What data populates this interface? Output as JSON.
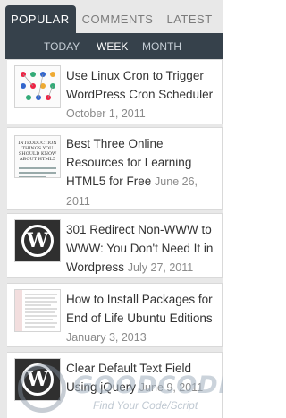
{
  "tabs": [
    "POPULAR",
    "COMMENTS",
    "LATEST"
  ],
  "subtabs": [
    "TODAY",
    "WEEK",
    "MONTH"
  ],
  "posts": [
    {
      "title": "Use Linux Cron to Trigger WordPress Cron Scheduler",
      "date": "October 1, 2011"
    },
    {
      "title": "Best Three Online Resources for Learning HTML5 for Free",
      "date": "June 26, 2011"
    },
    {
      "title": "301 Redirect Non-WWW to WWW: You Don't Need It in Wordpress",
      "date": "July 27, 2011"
    },
    {
      "title": "How to Install Packages for End of Life Ubuntu Editions",
      "date": "January 3, 2013"
    },
    {
      "title": "Clear Default Text Field Using jQuery",
      "date": "June 9, 2011"
    }
  ],
  "thumb_text": {
    "html5": "INTRODUCTION THINGS YOU SHOULD KNOW ABOUT HTML5"
  },
  "watermark": {
    "name": "GOODCODE",
    "tagline": "Find Your Code/Script"
  },
  "colors": {
    "tab_bar": "#36414b",
    "active_tab_text": "#ffffff",
    "date": "#8b8b8b"
  }
}
